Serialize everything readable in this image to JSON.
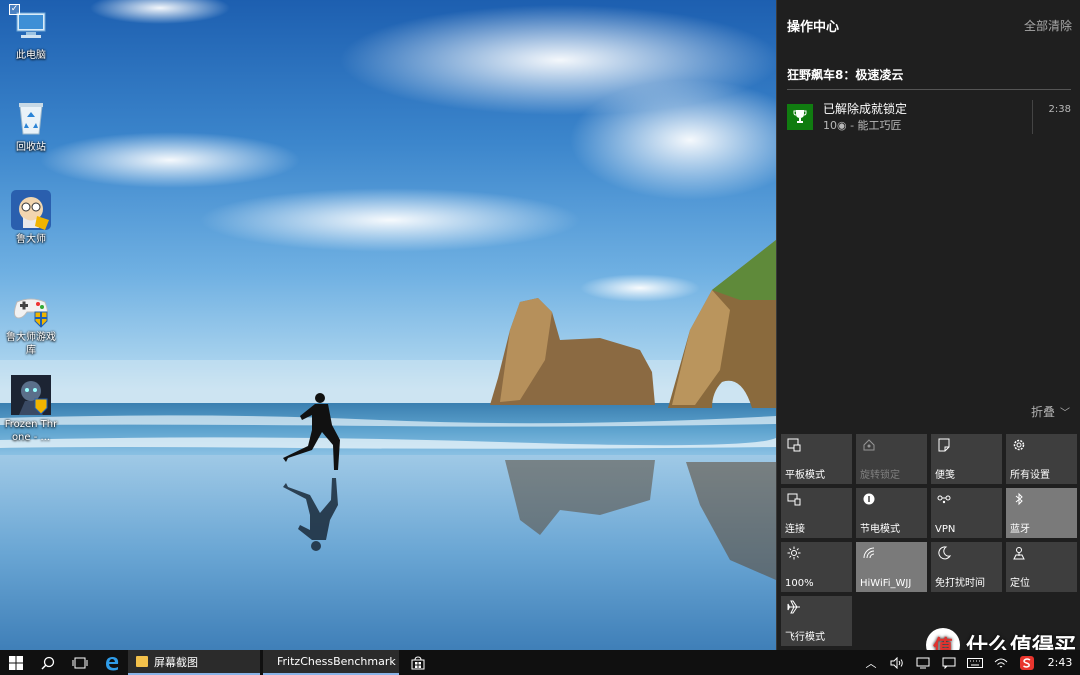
{
  "desktop": {
    "icons": [
      {
        "label": "此电脑",
        "icon": "computer-icon"
      },
      {
        "label": "回收站",
        "icon": "recycle-bin-icon"
      },
      {
        "label": "鲁大师",
        "icon": "ludashi-icon"
      },
      {
        "label": "鲁大师游戏库",
        "icon": "game-controller-icon"
      },
      {
        "label": "Frozen Throne - ...",
        "icon": "warcraft-icon"
      }
    ]
  },
  "action_center": {
    "title": "操作中心",
    "clear_all": "全部清除",
    "group_title": "狂野飙车8：极速凌云",
    "notification": {
      "title": "已解除成就锁定",
      "subtitle": "10◉ - 能工巧匠",
      "time": "2:38",
      "icon": "trophy-icon",
      "tile_color": "#107c10"
    },
    "collapse_label": "折叠",
    "quick_actions": [
      {
        "label": "平板模式",
        "icon": "tablet-mode-icon",
        "state": "off"
      },
      {
        "label": "旋转锁定",
        "icon": "rotation-lock-icon",
        "state": "disabled"
      },
      {
        "label": "便笺",
        "icon": "note-icon",
        "state": "off"
      },
      {
        "label": "所有设置",
        "icon": "gear-icon",
        "state": "off"
      },
      {
        "label": "连接",
        "icon": "connect-icon",
        "state": "off"
      },
      {
        "label": "节电模式",
        "icon": "battery-saver-icon",
        "state": "off"
      },
      {
        "label": "VPN",
        "icon": "vpn-icon",
        "state": "off"
      },
      {
        "label": "蓝牙",
        "icon": "bluetooth-icon",
        "state": "on"
      },
      {
        "label": "100%",
        "icon": "brightness-icon",
        "state": "off"
      },
      {
        "label": "HiWiFi_WJJ",
        "icon": "wifi-icon",
        "state": "on"
      },
      {
        "label": "免打扰时间",
        "icon": "moon-icon",
        "state": "off"
      },
      {
        "label": "定位",
        "icon": "location-icon",
        "state": "off"
      },
      {
        "label": "飞行模式",
        "icon": "airplane-icon",
        "state": "off"
      }
    ]
  },
  "taskbar": {
    "apps": [
      {
        "label": "屏幕截图",
        "icon": "folder-icon"
      },
      {
        "label": "FritzChessBenchmark",
        "icon": "folder-icon"
      }
    ],
    "clock": "2:43"
  },
  "watermark": {
    "logo": "值",
    "text": "什么值得买"
  },
  "colors": {
    "accent": "#107c10",
    "panel": "#1f1f1f",
    "tile": "#3e3e3e",
    "tile_on": "#7a7a7a"
  }
}
